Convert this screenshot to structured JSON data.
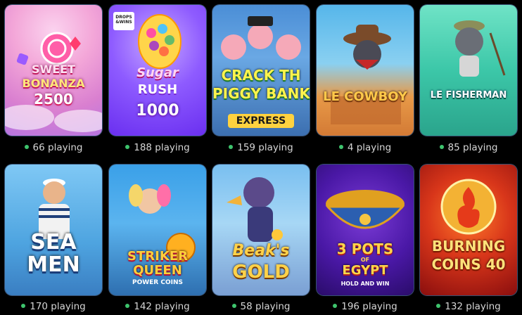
{
  "games": [
    {
      "id": "sweet-bonanza",
      "title_lines": [
        "SWEET",
        "BONANZA",
        "2500"
      ],
      "players": "66 playing"
    },
    {
      "id": "sugar-rush",
      "title_lines": [
        "Sugar",
        "RUSH",
        "1000"
      ],
      "badge": [
        "DROPS",
        "&WINS"
      ],
      "players": "188 playing"
    },
    {
      "id": "crack-piggy",
      "title_lines": [
        "CRACK TH",
        "PIGGY BANK",
        "EXPRESS"
      ],
      "players": "159 playing"
    },
    {
      "id": "le-cowboy",
      "title_lines": [
        "LE COWBOY"
      ],
      "players": "4 playing"
    },
    {
      "id": "le-fisherman",
      "title_lines": [
        "LE FISHERMAN"
      ],
      "players": "85 playing"
    },
    {
      "id": "sea-men",
      "title_lines": [
        "SEA",
        "MEN"
      ],
      "players": "170 playing"
    },
    {
      "id": "striker-queen",
      "title_lines": [
        "STRIKER",
        "QUEEN",
        "POWER COINS"
      ],
      "players": "142 playing"
    },
    {
      "id": "beaks-gold",
      "title_lines": [
        "Beak's",
        "GOLD"
      ],
      "players": "58 playing"
    },
    {
      "id": "3-pots-egypt",
      "title_lines": [
        "3 POTS",
        "OF",
        "EGYPT",
        "HOLD AND WIN"
      ],
      "players": "196 playing"
    },
    {
      "id": "burning-coins",
      "title_lines": [
        "BURNING",
        "COINS 40"
      ],
      "players": "132 playing"
    }
  ],
  "colors": {
    "status_dot": "#3ec46d",
    "count_text": "#d6d6d6",
    "background": "#000000"
  }
}
